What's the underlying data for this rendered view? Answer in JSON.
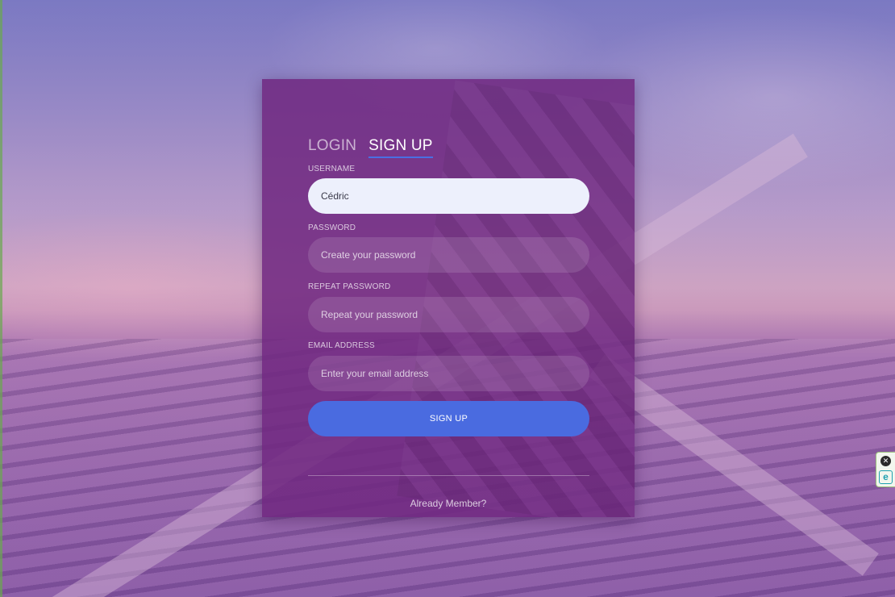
{
  "tabs": {
    "login_label": "LOGIN",
    "signup_label": "SIGN UP",
    "active": "SIGN UP"
  },
  "form": {
    "username": {
      "label": "USERNAME",
      "value": "Cédric"
    },
    "password": {
      "label": "PASSWORD",
      "placeholder": "Create your password",
      "value": ""
    },
    "repeat_password": {
      "label": "REPEAT PASSWORD",
      "placeholder": "Repeat your password",
      "value": ""
    },
    "email": {
      "label": "EMAIL ADDRESS",
      "placeholder": "Enter your email address",
      "value": ""
    },
    "submit_label": "SIGN UP"
  },
  "footer": {
    "link_text": "Already Member?"
  },
  "extension_widget": {
    "close_icon": "close-circle-icon",
    "logo_icon": "e-logo-icon",
    "close_glyph": "✕",
    "logo_glyph": "e"
  },
  "colors": {
    "card_background": "#702880",
    "accent_blue": "#4a6be0",
    "filled_input_background": "#edf0fc"
  }
}
